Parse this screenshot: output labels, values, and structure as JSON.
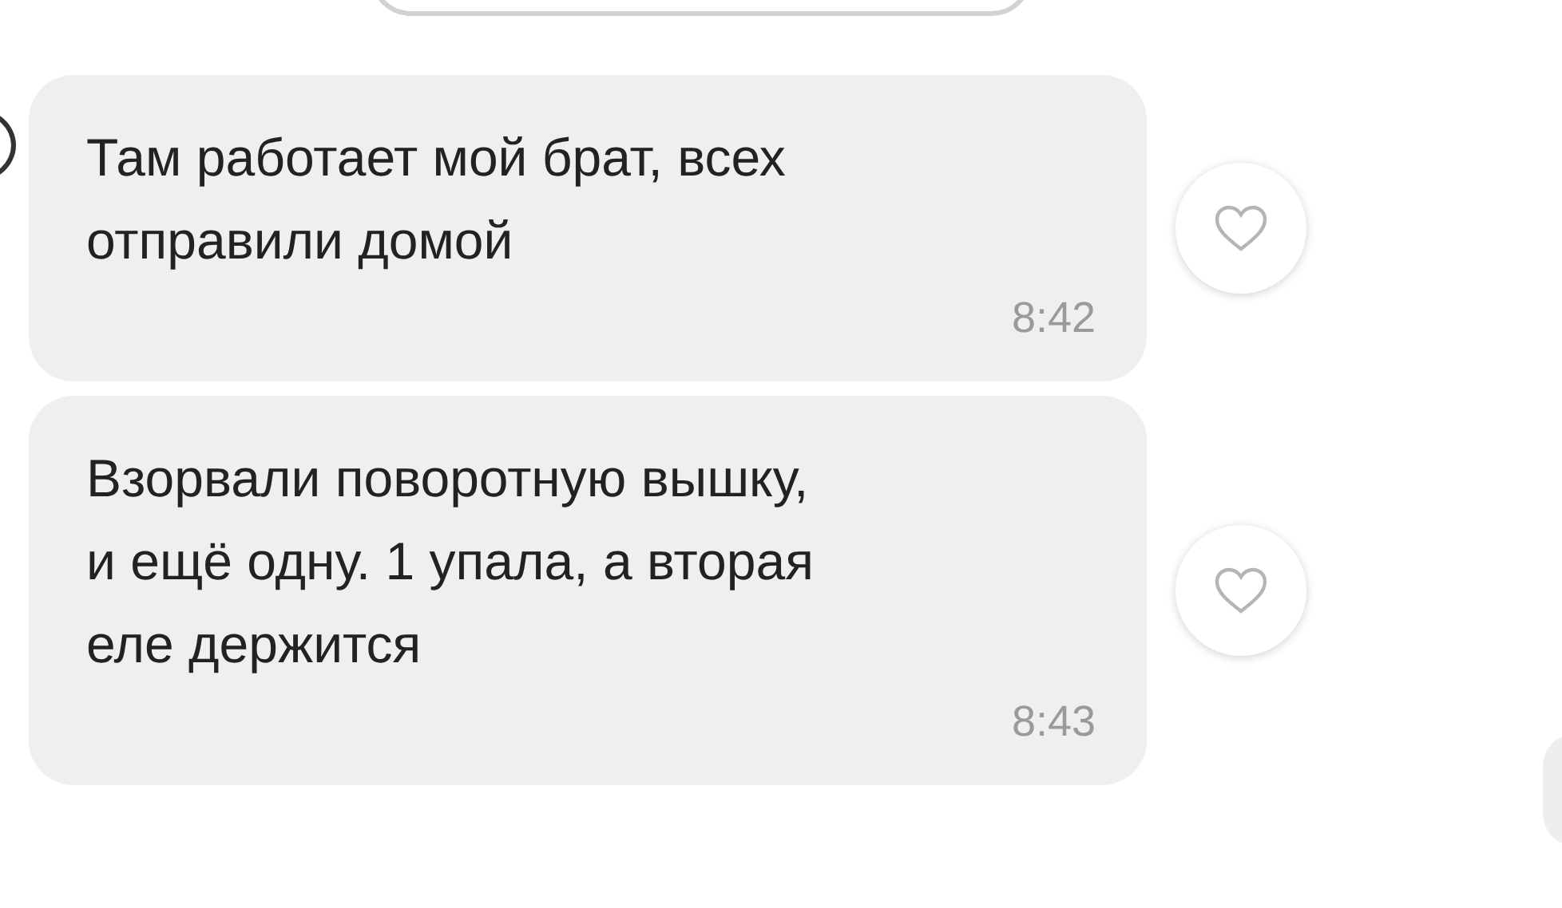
{
  "messages": [
    {
      "text": "Там работает мой брат, всех\nотправили домой",
      "time": "8:42",
      "liked": false
    },
    {
      "text": "Взорвали поворотную вышку,\nи ещё одну. 1 упала, а вторая\nеле держится",
      "time": "8:43",
      "liked": false
    }
  ]
}
